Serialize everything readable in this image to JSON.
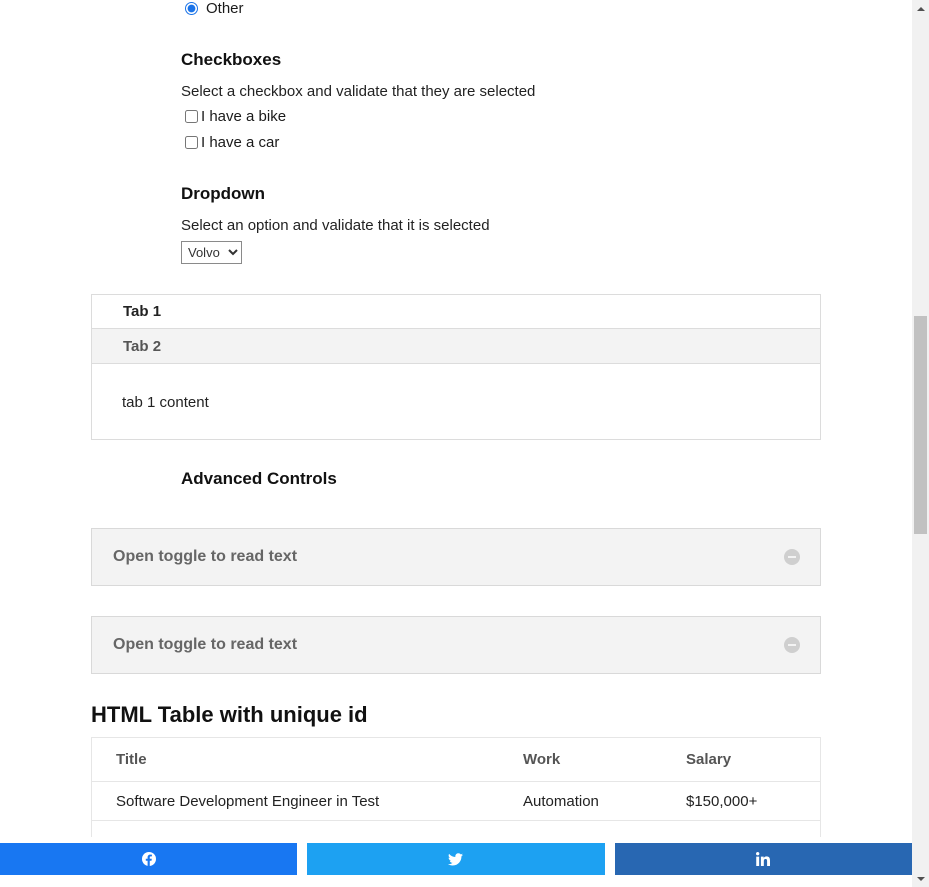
{
  "radio": {
    "label": "Other",
    "checked": true
  },
  "checkboxes": {
    "title": "Checkboxes",
    "description": "Select a checkbox and validate that they are selected",
    "items": [
      {
        "label": "I have a bike",
        "checked": false
      },
      {
        "label": "I have a car",
        "checked": false
      }
    ]
  },
  "dropdown": {
    "title": "Dropdown",
    "description": "Select an option and validate that it is selected",
    "selected": "Volvo"
  },
  "tabs": {
    "items": [
      {
        "label": "Tab 1",
        "active": true
      },
      {
        "label": "Tab 2",
        "active": false
      }
    ],
    "content": "tab 1 content"
  },
  "advanced": {
    "title": "Advanced Controls",
    "toggles": [
      {
        "label": "Open toggle to read text",
        "icon": "minus-circle-icon"
      },
      {
        "label": "Open toggle to read text",
        "icon": "minus-circle-icon"
      }
    ]
  },
  "table": {
    "title": "HTML Table with unique id",
    "headers": [
      "Title",
      "Work",
      "Salary"
    ],
    "rows": [
      [
        "Software Development Engineer in Test",
        "Automation",
        "$150,000+"
      ]
    ]
  },
  "share": {
    "buttons": [
      {
        "network": "facebook",
        "icon": "facebook-icon",
        "color": "#1877f2"
      },
      {
        "network": "twitter",
        "icon": "twitter-icon",
        "color": "#1da1f2"
      },
      {
        "network": "linkedin",
        "icon": "linkedin-icon",
        "color": "#2867b2"
      }
    ]
  }
}
